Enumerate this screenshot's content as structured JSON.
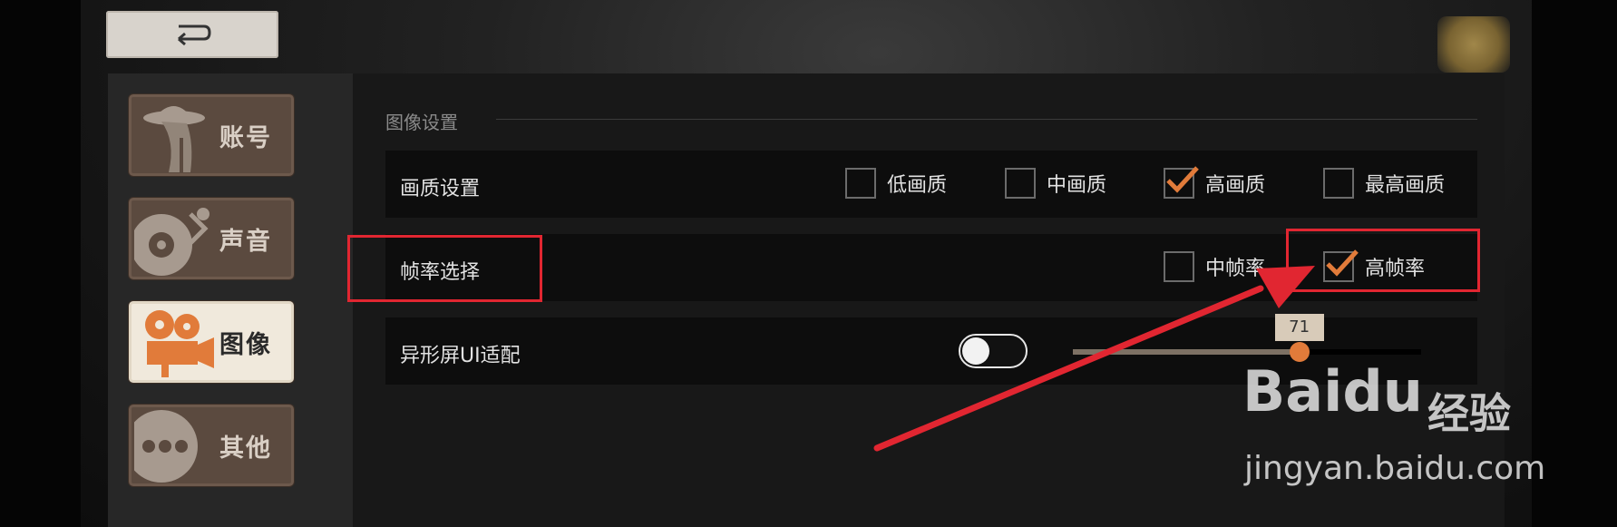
{
  "sidebar": {
    "items": [
      {
        "label": "账号",
        "icon": "detective-icon"
      },
      {
        "label": "声音",
        "icon": "turntable-icon"
      },
      {
        "label": "图像",
        "icon": "film-camera-icon",
        "active": true
      },
      {
        "label": "其他",
        "icon": "more-dots-icon"
      }
    ]
  },
  "back_button": {
    "icon": "return-arrow-icon"
  },
  "settings": {
    "section_title": "图像设置",
    "quality": {
      "label": "画质设置",
      "options": [
        "低画质",
        "中画质",
        "高画质",
        "最高画质"
      ],
      "selected": "高画质"
    },
    "framerate": {
      "label": "帧率选择",
      "options": [
        "中帧率",
        "高帧率"
      ],
      "selected": "高帧率"
    },
    "notch": {
      "label": "异形屏UI适配",
      "toggle_on": false,
      "slider_value": "71",
      "slider_fraction": 0.65
    }
  },
  "colors": {
    "accent_orange": "#e17b3a",
    "annotation_red": "#e12631"
  },
  "watermark": {
    "logo": "Baidu",
    "cn": "经验",
    "url": "jingyan.baidu.com"
  }
}
